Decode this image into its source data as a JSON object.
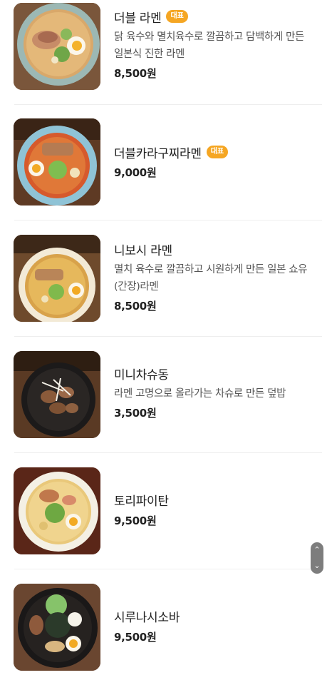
{
  "menu": {
    "items": [
      {
        "name": "더블 라멘",
        "badge": "대표",
        "description": "닭 육수와 멸치육수로 깔끔하고 담백하게 만든 일본식 진한 라멘",
        "price": "8,500원",
        "image": "ramen-tonkotsu-photo"
      },
      {
        "name": "더블카라구찌라멘",
        "badge": "대표",
        "description": "",
        "price": "9,000원",
        "image": "spicy-ramen-photo"
      },
      {
        "name": "니보시 라멘",
        "badge": "",
        "description": "멸치 육수로 깔끔하고 시원하게 만든 일본 쇼유(간장)라멘",
        "price": "8,500원",
        "image": "shoyu-ramen-photo"
      },
      {
        "name": "미니차슈동",
        "badge": "",
        "description": "라멘 고명으로 올라가는 차슈로 만든 덮밥",
        "price": "3,500원",
        "image": "chashu-rice-bowl-photo"
      },
      {
        "name": "토리파이탄",
        "badge": "",
        "description": "",
        "price": "9,500원",
        "image": "chicken-paitan-photo"
      },
      {
        "name": "시루나시소바",
        "badge": "",
        "description": "",
        "price": "9,500원",
        "image": "soupless-soba-photo"
      }
    ]
  },
  "scroll": {
    "up_icon": "chevron-up-icon",
    "down_icon": "chevron-down-icon",
    "up_glyph": "⌃",
    "down_glyph": "⌄"
  },
  "colors": {
    "badge": "#f5a623",
    "divider": "#eeeeee",
    "scroll_control": "#7d7d7d"
  }
}
